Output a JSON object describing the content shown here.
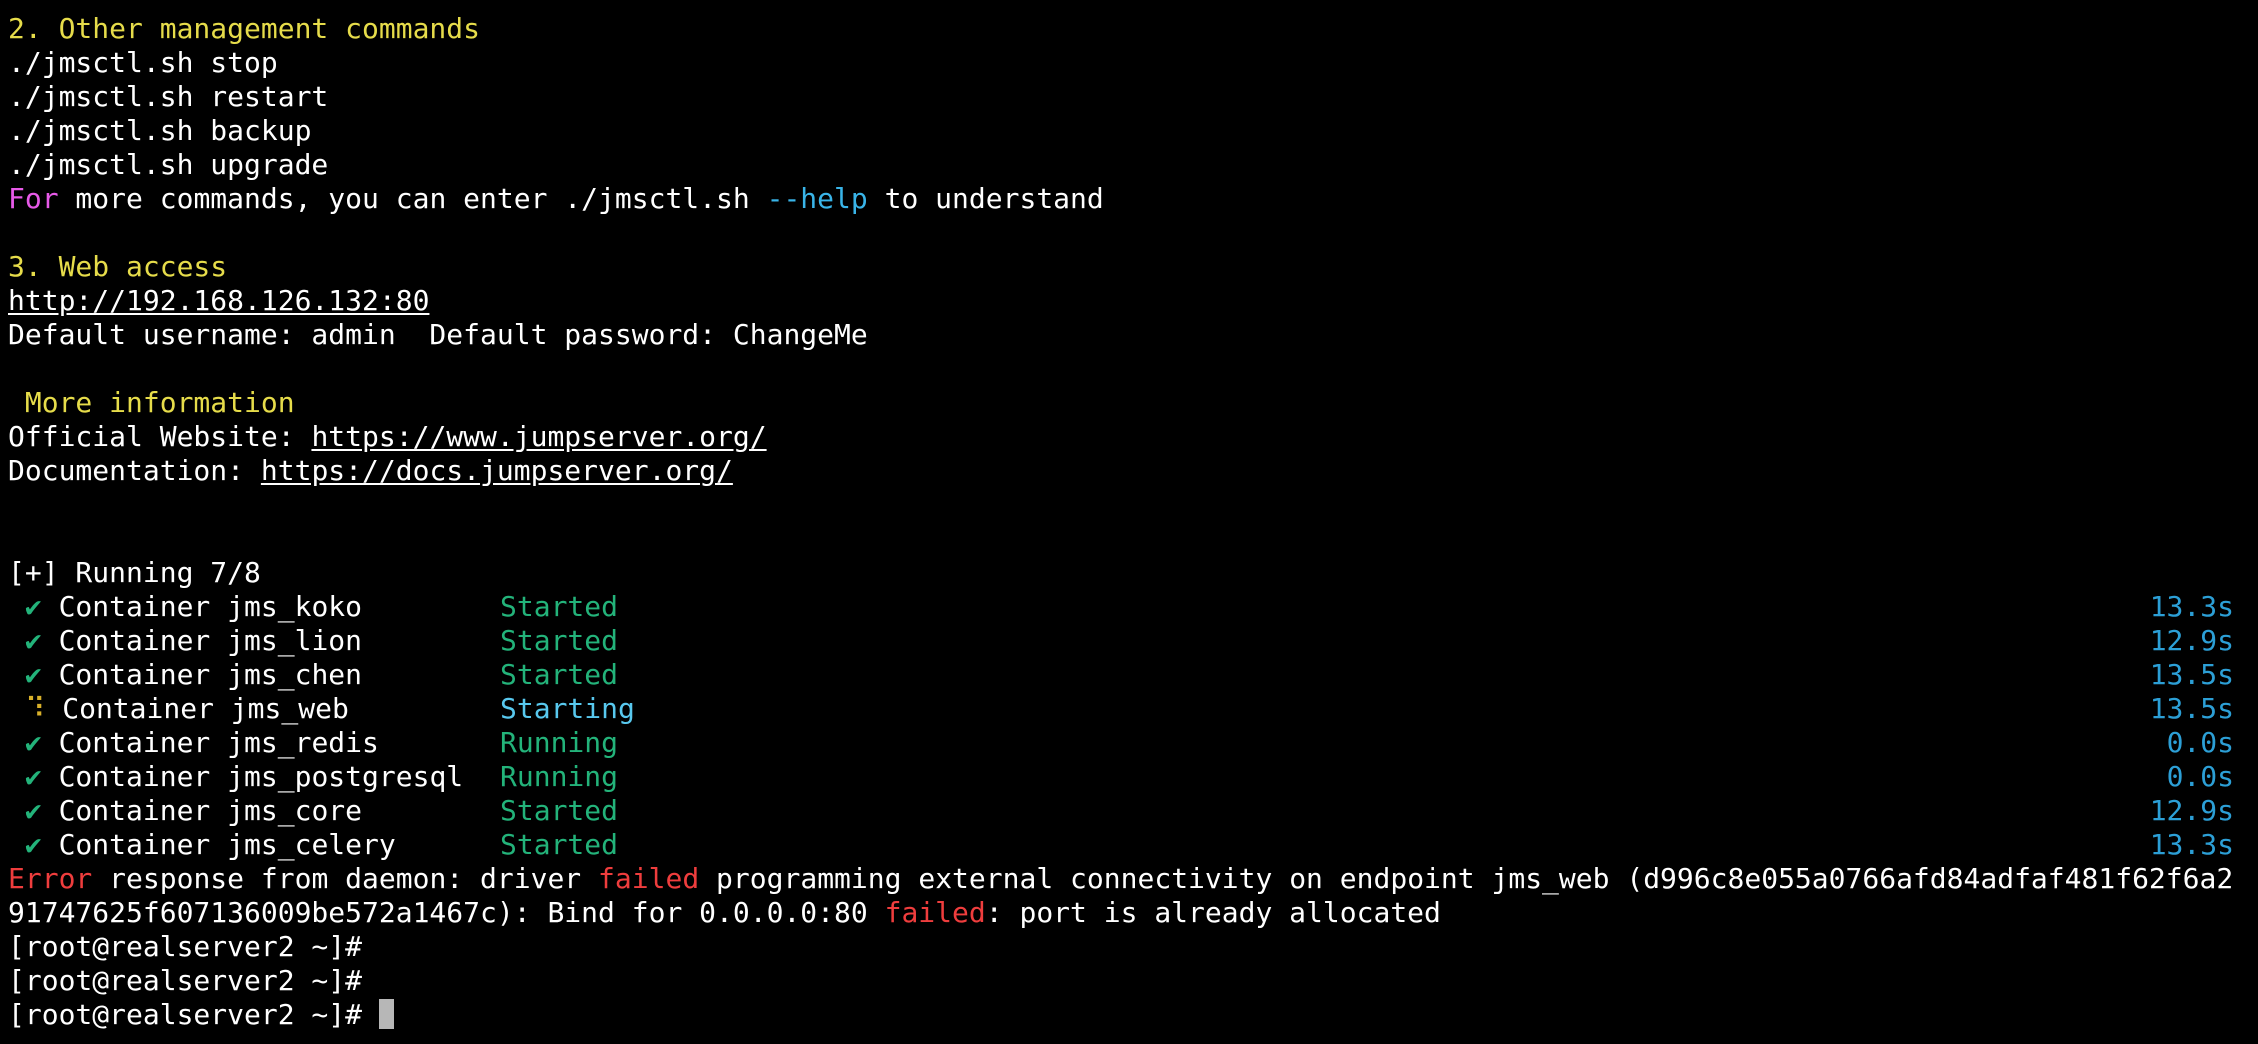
{
  "colors": {
    "background": "#000000",
    "text": "#ffffff",
    "heading": "#e6dc4a",
    "keyword": "#e75ae8",
    "flag": "#39b4e8",
    "success": "#23b37a",
    "starting": "#58c8ee",
    "error": "#ef3d3d",
    "duration": "#2c9fd6"
  },
  "section2": {
    "heading": "2. Other management commands",
    "commands": [
      "./jmsctl.sh stop",
      "./jmsctl.sh restart",
      "./jmsctl.sh backup",
      "./jmsctl.sh upgrade"
    ],
    "help": {
      "keyword": "For",
      "middle": " more commands, you can enter ./jmsctl.sh ",
      "flag": "--help",
      "end": " to understand"
    }
  },
  "section3": {
    "heading": "3. Web access",
    "url": "http://192.168.126.132:80",
    "credentials": "Default username: admin  Default password: ChangeMe"
  },
  "more_info": {
    "heading": " More information",
    "website_label": "Official Website: ",
    "website_url": "https://www.jumpserver.org/",
    "docs_label": "Documentation: ",
    "docs_url": "https://docs.jumpserver.org/"
  },
  "compose": {
    "header": "[+] Running 7/8",
    "containers": [
      {
        "icon": "✔",
        "name": " Container jms_koko",
        "status": "Started",
        "time": "13.3s"
      },
      {
        "icon": "✔",
        "name": " Container jms_lion",
        "status": "Started",
        "time": "12.9s"
      },
      {
        "icon": "✔",
        "name": " Container jms_chen",
        "status": "Started",
        "time": "13.5s"
      },
      {
        "icon": "⠹",
        "name": " Container jms_web",
        "status": "Starting",
        "time": "13.5s"
      },
      {
        "icon": "✔",
        "name": " Container jms_redis",
        "status": "Running",
        "time": "0.0s"
      },
      {
        "icon": "✔",
        "name": " Container jms_postgresql",
        "status": "Running",
        "time": "0.0s"
      },
      {
        "icon": "✔",
        "name": " Container jms_core",
        "status": "Started",
        "time": "12.9s"
      },
      {
        "icon": "✔",
        "name": " Container jms_celery",
        "status": "Started",
        "time": "13.3s"
      }
    ]
  },
  "error": {
    "line1_word1": "Error",
    "line1_part2": " response from daemon: driver ",
    "line1_word2": "failed",
    "line1_part3": " programming external connectivity on endpoint jms_web (d996c8e055a0766afd84adfaf481f62f6a2",
    "line2_part1": "91747625f607136009be572a1467c): Bind for 0.0.0.0:80 ",
    "line2_word": "failed",
    "line2_part2": ": port is already allocated"
  },
  "prompts": [
    "[root@realserver2 ~]#",
    "[root@realserver2 ~]#",
    "[root@realserver2 ~]# "
  ]
}
